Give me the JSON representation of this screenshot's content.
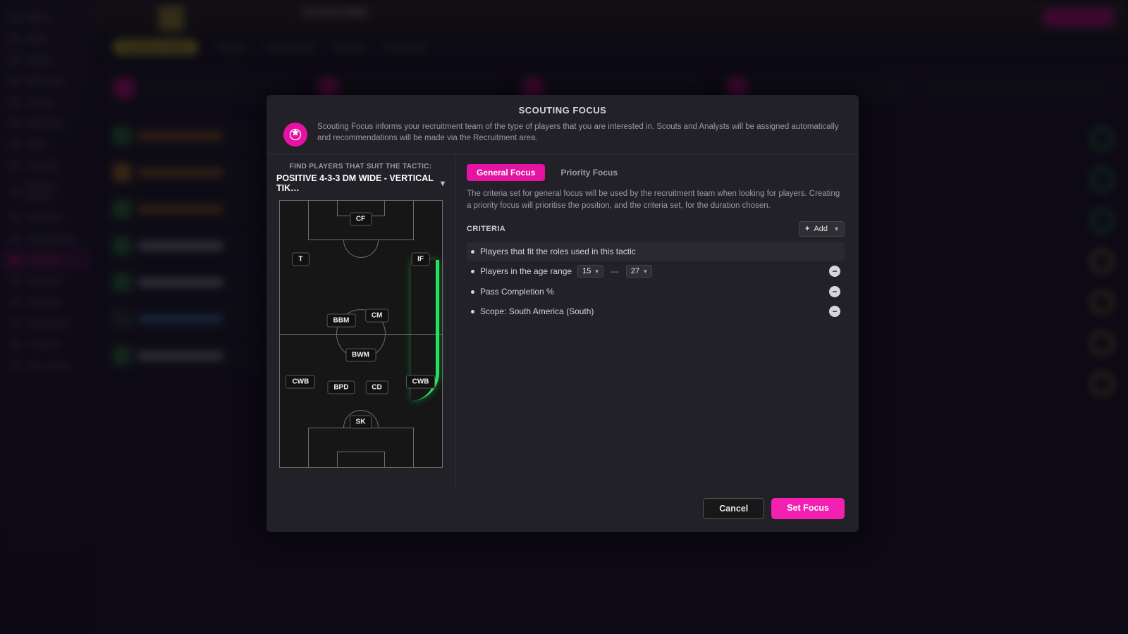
{
  "sidebar": {
    "items": [
      {
        "label": "Home"
      },
      {
        "label": "Inbox"
      },
      {
        "label": "Squad"
      },
      {
        "label": "Dynamics"
      },
      {
        "label": "Tactics"
      },
      {
        "label": "Data Hub"
      },
      {
        "label": "Staff"
      },
      {
        "label": "Training"
      },
      {
        "label": "Medical Centre"
      },
      {
        "label": "Schedule"
      },
      {
        "label": "Competitions"
      },
      {
        "label": "Scouting"
      },
      {
        "label": "Transfers"
      },
      {
        "label": "Club Info"
      },
      {
        "label": "Club Vision"
      },
      {
        "label": "Finances"
      },
      {
        "label": "Dev. Centre"
      }
    ],
    "active_index": 11
  },
  "topbar": {
    "title": "SCOUTING",
    "subnav": {
      "pill": "Scouting Centre",
      "items": [
        "Players",
        "Assignments",
        "Shortlist",
        "Knowledge"
      ]
    }
  },
  "modal": {
    "title": "SCOUTING FOCUS",
    "intro": "Scouting Focus informs your recruitment team of the type of players that you are interested in. Scouts and Analysts will be assigned automatically and recommendations will be made via the Recruitment area.",
    "tactic_caption": "FIND PLAYERS THAT SUIT THE TACTIC:",
    "tactic_name": "POSITIVE 4-3-3 DM WIDE - VERTICAL TIK…",
    "roles": {
      "cf": "CF",
      "t": "T",
      "if": "IF",
      "bbm": "BBM",
      "cm": "CM",
      "bwm": "BWM",
      "cwb_l": "CWB",
      "bpd": "BPD",
      "cd": "CD",
      "cwb_r": "CWB",
      "sk": "SK"
    },
    "tabs": {
      "general": "General Focus",
      "priority": "Priority Focus"
    },
    "focus_description": "The criteria set for general focus will be used by the recruitment team when looking for players. Creating a priority focus will prioritise the position, and the criteria set, for the duration chosen.",
    "criteria_label": "CRITERIA",
    "add_label": "Add",
    "criteria": {
      "roles": "Players that fit the roles used in this tactic",
      "age_prefix": "Players in the age range",
      "age_min": "15",
      "age_max": "27",
      "pass": "Pass Completion %",
      "scope": "Scope: South America (South)"
    },
    "footer": {
      "cancel": "Cancel",
      "set": "Set Focus"
    }
  }
}
